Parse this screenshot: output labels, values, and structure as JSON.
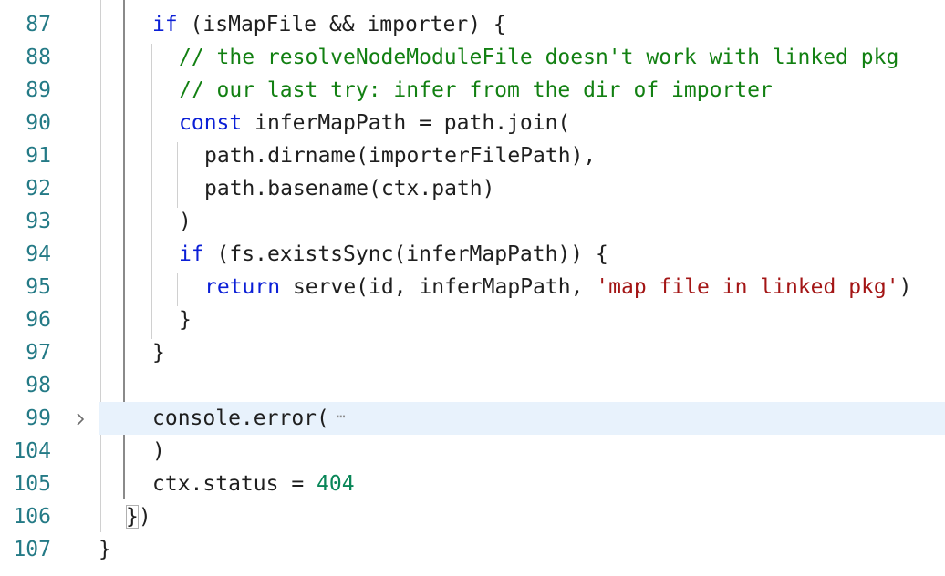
{
  "editor": {
    "colors": {
      "line_number": "#247a86",
      "keyword": "#0b1fd6",
      "comment": "#128012",
      "string": "#a31515",
      "number": "#098658",
      "highlight": "#e8f2fc"
    },
    "lines": [
      {
        "number": "87",
        "text_before": "if",
        "text": " (isMapFile && importer) {"
      },
      {
        "number": "88",
        "comment": "// the resolveNodeModuleFile doesn't work with linked pkg"
      },
      {
        "number": "89",
        "comment": "// our last try: infer from the dir of importer"
      },
      {
        "number": "90",
        "keyword": "const",
        "text": " inferMapPath = path.join("
      },
      {
        "number": "91",
        "text": "path.dirname(importerFilePath),"
      },
      {
        "number": "92",
        "text": "path.basename(ctx.path)"
      },
      {
        "number": "93",
        "text": ")"
      },
      {
        "number": "94",
        "keyword": "if",
        "text": " (fs.existsSync(inferMapPath)) {"
      },
      {
        "number": "95",
        "keyword": "return",
        "text": " serve(id, inferMapPath, ",
        "string": "'map file in linked pkg'",
        "text_after": ")"
      },
      {
        "number": "96",
        "text": "}"
      },
      {
        "number": "97",
        "text": "}"
      },
      {
        "number": "98",
        "text": ""
      },
      {
        "number": "99",
        "text": "console.error(",
        "fold_icon": "chevron-right",
        "ellipsis": "⋯"
      },
      {
        "number": "104",
        "text": ")"
      },
      {
        "number": "105",
        "text": "ctx.status = ",
        "number_literal": "404"
      },
      {
        "number": "106",
        "bracket": "}",
        "text": ")"
      },
      {
        "number": "107",
        "text": "}"
      }
    ]
  }
}
